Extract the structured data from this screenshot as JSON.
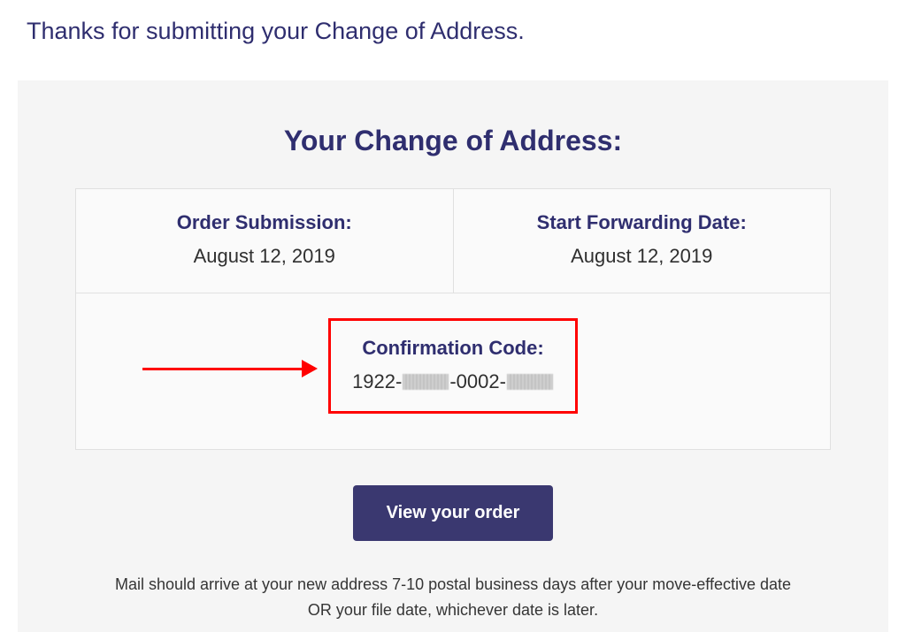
{
  "thanks": "Thanks for submitting your Change of Address.",
  "card": {
    "title": "Your Change of Address:",
    "order_submission_label": "Order Submission:",
    "order_submission_value": "August 12, 2019",
    "start_forwarding_label": "Start Forwarding Date:",
    "start_forwarding_value": "August 12, 2019",
    "confirmation_label": "Confirmation Code:",
    "confirmation_parts": {
      "p1": "1922-",
      "p2": "-0002-"
    },
    "button_label": "View your order",
    "footer": "Mail should arrive at your new address 7-10 postal business days after your move-effective date OR your file date, whichever date is later."
  }
}
